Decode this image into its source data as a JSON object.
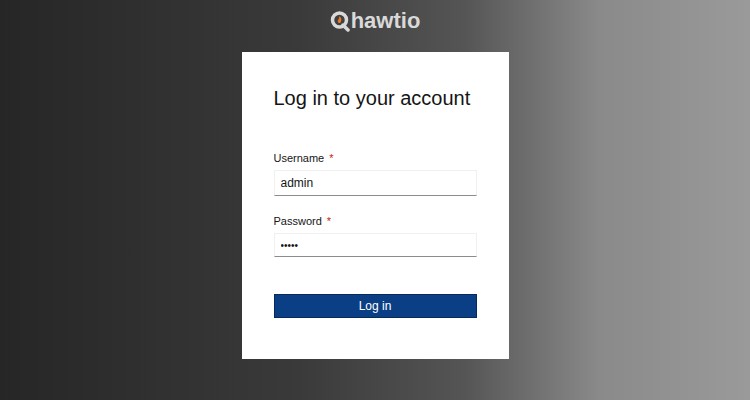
{
  "logo": {
    "text": "hawtio"
  },
  "form": {
    "title": "Log in to your account",
    "fields": [
      {
        "label": "Username",
        "required_mark": "*",
        "value": "admin",
        "kind": "text"
      },
      {
        "label": "Password",
        "required_mark": "*",
        "value": "•••••",
        "kind": "password"
      }
    ],
    "submit": "Log in"
  }
}
